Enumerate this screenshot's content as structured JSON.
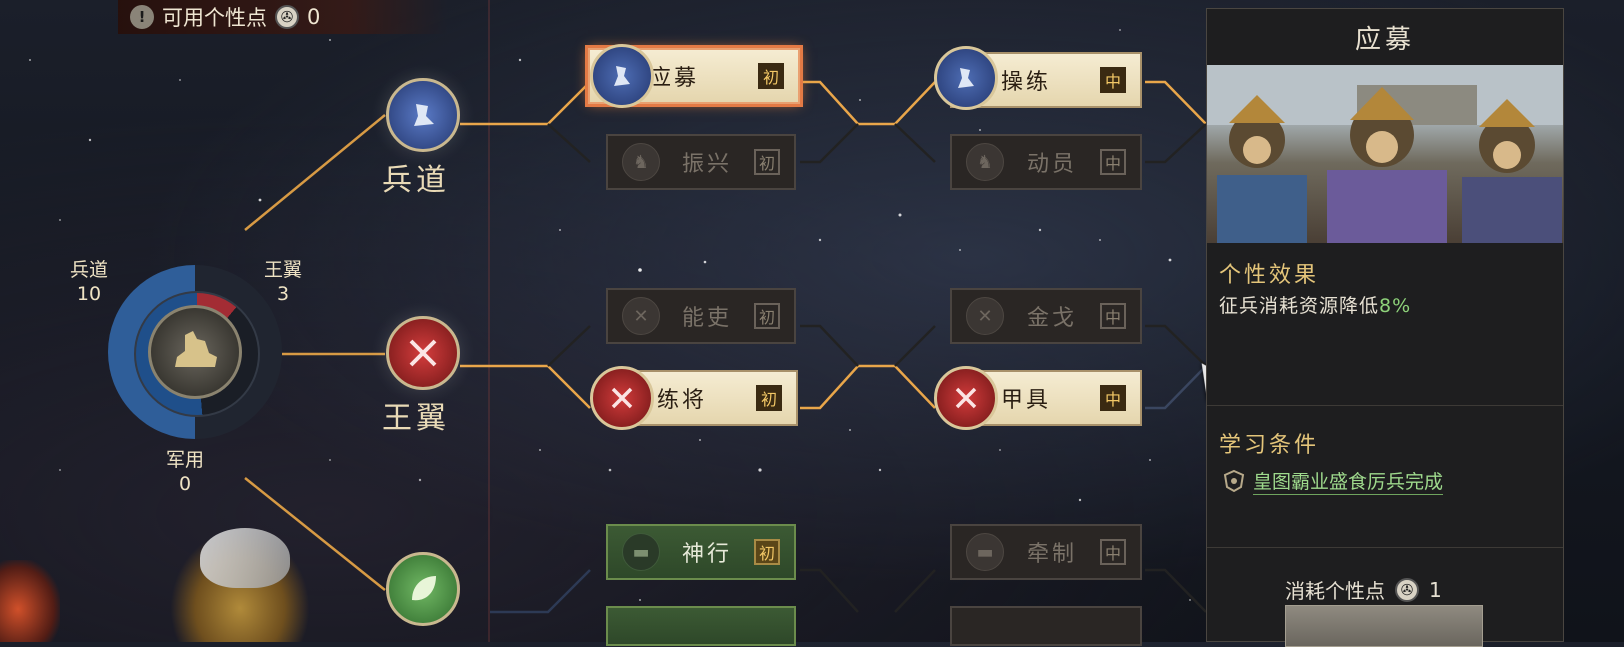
{
  "topbar": {
    "label": "可用个性点",
    "points": "0"
  },
  "ring": {
    "left_label": "兵道",
    "left_value": "10",
    "right_label": "王翼",
    "right_value": "3",
    "bottom_label": "军用",
    "bottom_value": "0"
  },
  "paths": [
    {
      "name": "兵道"
    },
    {
      "name": "王翼"
    }
  ],
  "nodes": {
    "yingmu": {
      "label": "应募",
      "tier": "初"
    },
    "zhenxing": {
      "label": "振兴",
      "tier": "初"
    },
    "caolian": {
      "label": "操练",
      "tier": "中"
    },
    "dongyuan": {
      "label": "动员",
      "tier": "中"
    },
    "nengli": {
      "label": "能吏",
      "tier": "初"
    },
    "lianjiang": {
      "label": "练将",
      "tier": "初"
    },
    "jinge": {
      "label": "金戈",
      "tier": "中"
    },
    "jiaju": {
      "label": "甲具",
      "tier": "中"
    },
    "shenxing": {
      "label": "神行",
      "tier": "初"
    },
    "qianzhi": {
      "label": "牵制",
      "tier": "中"
    }
  },
  "panel": {
    "title": "应募",
    "effect_heading": "个性效果",
    "effect_text": "征兵消耗资源降低",
    "effect_value": "8%",
    "req_heading": "学习条件",
    "req_text": "皇图霸业盛食厉兵完成",
    "cost_label": "消耗个性点",
    "cost_value": "1"
  }
}
